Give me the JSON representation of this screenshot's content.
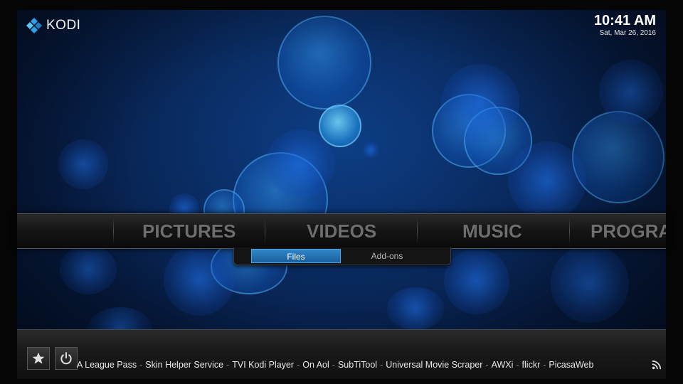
{
  "app": {
    "logo_text": "KODI",
    "accent_color": "#2f86c8"
  },
  "clock": {
    "time": "10:41 AM",
    "date": "Sat, Mar 26, 2016"
  },
  "main_menu": {
    "items": [
      {
        "label": "PICTURES"
      },
      {
        "label": "VIDEOS"
      },
      {
        "label": "MUSIC"
      },
      {
        "label": "PROGRA"
      }
    ]
  },
  "submenu": {
    "items": [
      {
        "label": "Files",
        "active": true
      },
      {
        "label": "Add-ons",
        "active": false
      }
    ]
  },
  "bottom_bar": {
    "favourites_icon": "star-icon",
    "power_icon": "power-icon",
    "rss_icon": "rss-icon",
    "addons": [
      "A League Pass",
      "Skin Helper Service",
      "TVI Kodi Player",
      "On Aol",
      "SubTiTool",
      "Universal Movie Scraper",
      "AWXi",
      "flickr",
      "PicasaWeb"
    ]
  }
}
